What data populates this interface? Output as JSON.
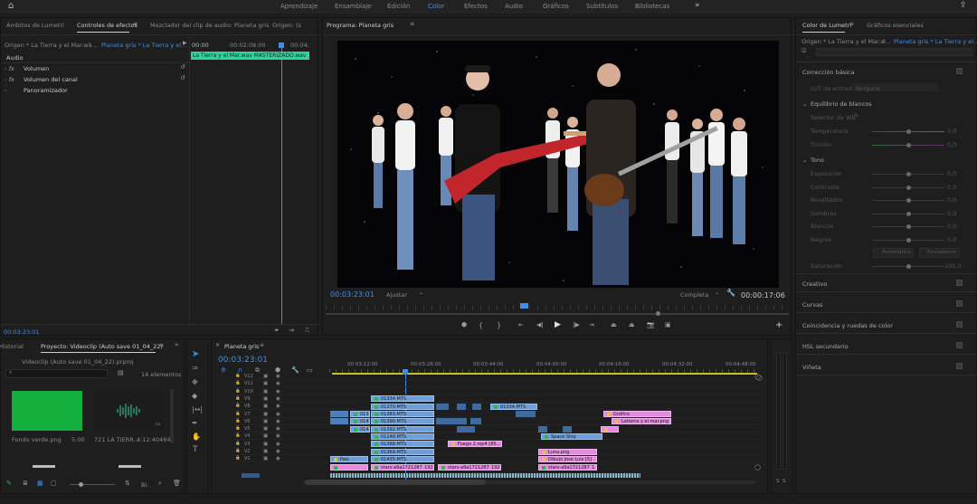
{
  "topbar": {
    "workspaces": [
      "Aprendizaje",
      "Ensamblaje",
      "Edición",
      "Color",
      "Efectos",
      "Audio",
      "Gráficos",
      "Subtítulos",
      "Bibliotecas"
    ],
    "active": "Color",
    "more": "»"
  },
  "effect_controls": {
    "tabs": [
      "Ámbitos de Lumetri",
      "Controles de efectos",
      "Mezclador del clip de audio: Planeta gris",
      "Origen: (s"
    ],
    "source_left": "Origen * La Tierra y el Mar.wa...",
    "source_right": "Planeta gris * La Tierra y el...",
    "section": "Audio",
    "effects": [
      "Volumen",
      "Volumen del canal",
      "Panoramizador"
    ],
    "times": [
      "00:00",
      "00:02:08:00",
      "00:04:"
    ],
    "clip_label": "La Tierra y el Mar.wav MASTERIZADO.wav",
    "timecode": "00:03:23:01"
  },
  "program": {
    "title": "Programa: Planeta gris",
    "timecode": "00:03:23:01",
    "fit": "Ajustar",
    "quality": "Completa",
    "duration": "00:00:17:06"
  },
  "lumetri": {
    "tabs": [
      "Color de Lumetri",
      "Gráficos esenciales"
    ],
    "source_left": "Origen * La Tierra y el Mar.w...",
    "source_right": "Planeta gris * La Tierra y el...",
    "sections": {
      "basic": "Corrección básica",
      "lut": "LUT de entrada",
      "lut_value": "Ninguno",
      "wb": "Equilibrio de blancos",
      "wb_selector": "Selector de WB",
      "tone": "Tono",
      "auto": "Automático",
      "reset": "Restablecer",
      "saturation": "Saturación",
      "creative": "Creativo",
      "curves": "Curvas",
      "color_match": "Coincidencia y ruedas de color",
      "hsl": "HSL secundario",
      "vignette": "Viñeta"
    },
    "sliders": [
      {
        "name": "Temperatura",
        "value": "0,0"
      },
      {
        "name": "Tinción",
        "value": "0,0"
      },
      {
        "name": "Exposición",
        "value": "0,0"
      },
      {
        "name": "Contraste",
        "value": "0,0"
      },
      {
        "name": "Resaltados",
        "value": "0,0"
      },
      {
        "name": "Sombras",
        "value": "0,0"
      },
      {
        "name": "Blancos",
        "value": "0,0"
      },
      {
        "name": "Negros",
        "value": "0,0"
      }
    ],
    "saturation_value": "100,0"
  },
  "project": {
    "tabs": [
      "Historial",
      "Proyecto: Videoclip (Auto save 01_04_22)"
    ],
    "file": "Videoclip (Auto save 01_04_22).prproj",
    "count": "14 elementos",
    "items": [
      {
        "name": "Fondo verde.png",
        "duration": "5:00"
      },
      {
        "name": "721 LA TIERR...",
        "duration": "4:12:40464"
      }
    ],
    "button": "Bi."
  },
  "timeline": {
    "title": "Planeta gris",
    "timecode": "00:03:23:01",
    "ruler": [
      "00:03:12:00",
      "00:03:28:00",
      "00:03:44:00",
      "00:04:00:00",
      "00:04:16:00",
      "00:04:32:00",
      "00:04:48:00"
    ],
    "tracks": [
      "V12",
      "V11",
      "V10",
      "V9",
      "V8",
      "V7",
      "V6",
      "V5",
      "V4",
      "V3",
      "V2",
      "V1"
    ],
    "clips": {
      "c1": "01334.MTS",
      "c2": "01370.MTS",
      "c3": "01383.MTS",
      "c4": "01390.MTS",
      "c5": "01392.MTS",
      "c6": "01148.MTS",
      "c7": "01368.MTS",
      "c8": "01369.MTS",
      "c9": "01435.MTS",
      "c10": "stars-a9a1721287_192",
      "c11": "stars-a9a1721287_1920",
      "c12": "01334.MTS",
      "c13": "Fuego 2.mp4 [85...",
      "c14": "Space Ship",
      "c15": "Luna.png",
      "c16": "Dibujo Jose Luis [5]",
      "c17": "stars-a9a1721287_1",
      "c18": "Gráfico",
      "c19": "Latierra y el mar.png",
      "c20": "Pais",
      "c21": "0131",
      "c22": "0142",
      "c23": "0142"
    },
    "meter": [
      "S",
      "S"
    ]
  },
  "colors": {
    "accent": "#3f8fe6",
    "clip_blue": "#6f9fd8",
    "clip_pink": "#e58be0",
    "audio_green": "#2fd39a"
  }
}
